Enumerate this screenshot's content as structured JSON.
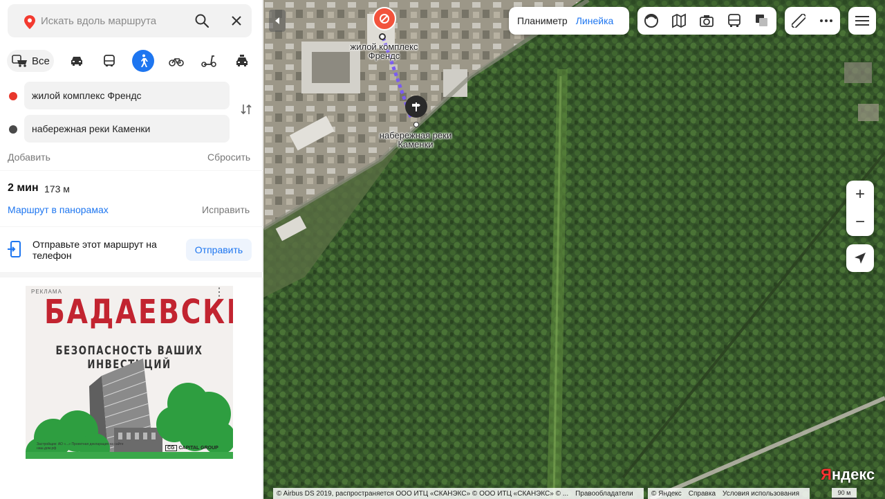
{
  "search": {
    "placeholder": "Искать вдоль маршрута"
  },
  "modes": {
    "all_label": "Все",
    "items": [
      "car-icon",
      "bus-icon",
      "walk-icon",
      "bike-icon",
      "scooter-icon",
      "taxi-icon"
    ],
    "active": "walk-icon"
  },
  "route": {
    "from": "жилой комплекс Френдс",
    "to": "набережная реки Каменки",
    "from_color": "#e8372c",
    "to_color": "#4a4a4a",
    "add_label": "Добавить",
    "reset_label": "Сбросить",
    "time": "2 мин",
    "distance": "173 м",
    "panorama_label": "Маршрут в панорамах",
    "fix_label": "Исправить"
  },
  "send": {
    "text": "Отправьте этот маршрут на телефон",
    "button": "Отправить"
  },
  "ad": {
    "label": "РЕКЛАМА",
    "brand": "БАДАЕВСКИЙ",
    "tagline": "БЕЗОПАСНОСТЬ ВАШИХ ИНВЕСТИЦИЙ",
    "legal": "Застройщик: АО «...»  Проектная декларация на сайте наш.дом.рф",
    "company_mark": "CG",
    "company": "CAPITAL GROUP"
  },
  "map": {
    "toolbar": {
      "planimeter": "Планиметр",
      "ruler": "Линейка"
    },
    "labels": {
      "point_a": "жилой комплекс Френдс",
      "point_b": "набережная реки Каменки"
    },
    "zoom_in": "+",
    "zoom_out": "−",
    "logo": "Яндекс",
    "attribution": "© Airbus DS 2019, распространяется ООО ИТЦ «СКАНЭКС» © ООО ИТЦ «СКАНЭКС» © ...",
    "owners": "Правообладатели",
    "yandex_copy": "© Яндекс",
    "help": "Справка",
    "terms": "Условия использования",
    "scale": "90 м",
    "accent": "#1e76f0"
  }
}
